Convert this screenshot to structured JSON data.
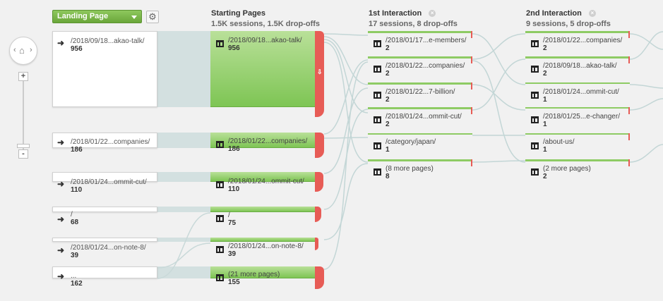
{
  "toolbar": {
    "dimension_label": "Landing Page",
    "gear_icon": "gear-icon"
  },
  "columns": {
    "starting": {
      "title": "Starting Pages",
      "subtitle": "1.5K sessions, 1.5K drop-offs"
    },
    "first": {
      "title": "1st Interaction",
      "subtitle": "17 sessions, 8 drop-offs",
      "close": "×"
    },
    "second": {
      "title": "2nd Interaction",
      "subtitle": "9 sessions, 5 drop-offs",
      "close": "×"
    }
  },
  "nav": {
    "left": "‹",
    "home": "⌂",
    "right": "›",
    "zoom_in": "+",
    "zoom_out": "-"
  },
  "landing": [
    {
      "name": "/2018/09/18...akao-talk/",
      "count": "956"
    },
    {
      "name": "/2018/01/22...companies/",
      "count": "186"
    },
    {
      "name": "/2018/01/24...ommit-cut/",
      "count": "110"
    },
    {
      "name": "/",
      "count": "68"
    },
    {
      "name": "/2018/01/24...on-note-8/",
      "count": "39"
    },
    {
      "name": "...",
      "count": "162"
    }
  ],
  "starting_pages": [
    {
      "name": "/2018/09/18...akao-talk/",
      "count": "956"
    },
    {
      "name": "/2018/01/22...companies/",
      "count": "186"
    },
    {
      "name": "/2018/01/24...ommit-cut/",
      "count": "110"
    },
    {
      "name": "/",
      "count": "75"
    },
    {
      "name": "/2018/01/24...on-note-8/",
      "count": "39"
    },
    {
      "name": "(21 more pages)",
      "count": "155"
    }
  ],
  "first_interaction": [
    {
      "name": "/2018/01/17...e-members/",
      "count": "2"
    },
    {
      "name": "/2018/01/22...companies/",
      "count": "2"
    },
    {
      "name": "/2018/01/22...7-billion/",
      "count": "2"
    },
    {
      "name": "/2018/01/24...ommit-cut/",
      "count": "2"
    },
    {
      "name": "/category/japan/",
      "count": "1"
    },
    {
      "name": "(8 more pages)",
      "count": "8"
    }
  ],
  "second_interaction": [
    {
      "name": "/2018/01/22...companies/",
      "count": "2"
    },
    {
      "name": "/2018/09/18...akao-talk/",
      "count": "2"
    },
    {
      "name": "/2018/01/24...ommit-cut/",
      "count": "1"
    },
    {
      "name": "/2018/01/25...e-changer/",
      "count": "1"
    },
    {
      "name": "/about-us/",
      "count": "1"
    },
    {
      "name": "(2 more pages)",
      "count": "2"
    }
  ],
  "drop_mark": "⇩",
  "colors": {
    "accent_green": "#7ec554",
    "dropoff_red": "#e75c56",
    "flow_gray": "#d3e0e0"
  }
}
